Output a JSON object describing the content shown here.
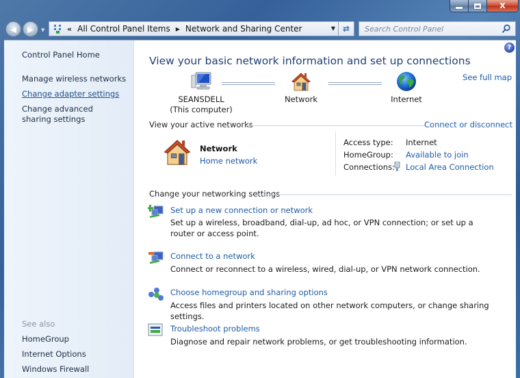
{
  "window": {
    "controls": {
      "minimize": "minimize",
      "maximize": "maximize",
      "close": "X"
    }
  },
  "nav": {
    "back_icon": "back-arrow-icon",
    "forward_icon": "forward-arrow-icon",
    "overflow": "«",
    "breadcrumb": [
      "All Control Panel Items",
      "Network and Sharing Center"
    ],
    "search_placeholder": "Search Control Panel"
  },
  "sidebar": {
    "home": "Control Panel Home",
    "tasks": [
      {
        "label": "Manage wireless networks",
        "hovered": false
      },
      {
        "label": "Change adapter settings",
        "hovered": true
      },
      {
        "label": "Change advanced sharing settings",
        "hovered": false
      }
    ],
    "see_also_label": "See also",
    "see_also": [
      "HomeGroup",
      "Internet Options",
      "Windows Firewall"
    ]
  },
  "main": {
    "help": "?",
    "title": "View your basic network information and set up connections",
    "see_full_map": "See full map",
    "map": [
      {
        "name": "SEANSDELL",
        "sub": "(This computer)",
        "icon": "computer-icon"
      },
      {
        "name": "Network",
        "sub": "",
        "icon": "house-icon"
      },
      {
        "name": "Internet",
        "sub": "",
        "icon": "globe-icon"
      }
    ],
    "active_networks": {
      "heading": "View your active networks",
      "connect_link": "Connect or disconnect",
      "network_name": "Network",
      "network_type": "Home network",
      "details": [
        {
          "key": "Access type:",
          "value": "Internet",
          "link": false
        },
        {
          "key": "HomeGroup:",
          "value": "Available to join",
          "link": true
        },
        {
          "key": "Connections:",
          "value": "Local Area Connection",
          "link": true
        }
      ]
    },
    "settings": {
      "heading": "Change your networking settings",
      "tasks": [
        {
          "title": "Set up a new connection or network",
          "desc": "Set up a wireless, broadband, dial-up, ad hoc, or VPN connection; or set up a router or access point.",
          "icon": "new-connection-icon"
        },
        {
          "title": "Connect to a network",
          "desc": "Connect or reconnect to a wireless, wired, dial-up, or VPN network connection.",
          "icon": "connect-network-icon"
        },
        {
          "title": "Choose homegroup and sharing options",
          "desc": "Access files and printers located on other network computers, or change sharing settings.",
          "icon": "homegroup-icon"
        },
        {
          "title": "Troubleshoot problems",
          "desc": "Diagnose and repair network problems, or get troubleshooting information.",
          "icon": "troubleshoot-icon"
        }
      ]
    }
  },
  "colors": {
    "link": "#1e5ba8",
    "title": "#1f3f76",
    "sidebar_bg": "#e9f0f9",
    "chrome": "#3e6ea6"
  }
}
